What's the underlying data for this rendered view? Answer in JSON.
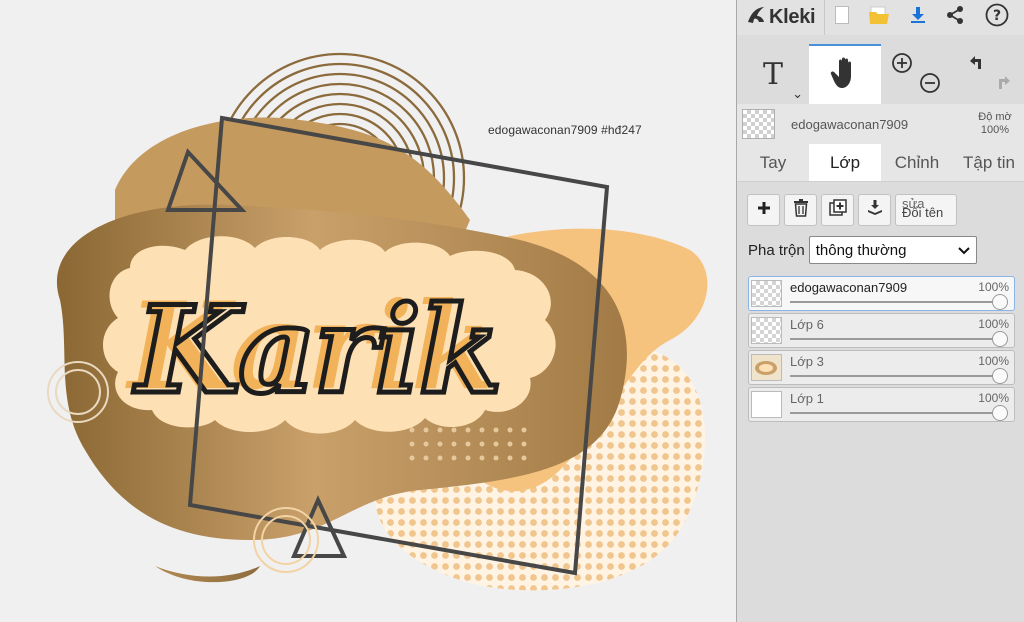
{
  "app": {
    "title": "Kleki"
  },
  "topbar": {
    "icons": [
      "kleki-logo-icon",
      "new-document-icon",
      "open-folder-icon",
      "download-icon",
      "share-icon",
      "help-icon"
    ]
  },
  "tools": {
    "text_label": "T",
    "items": [
      "text-tool-icon",
      "hand-tool-icon",
      "zoom-in-icon",
      "zoom-out-icon",
      "undo-icon",
      "redo-icon"
    ]
  },
  "layer_info": {
    "name": "edogawaconan7909",
    "opacity_label": "Độ mờ",
    "opacity_value": "100%"
  },
  "tabs": [
    {
      "label": "Tay",
      "active": false
    },
    {
      "label": "Lớp",
      "active": true
    },
    {
      "label": "Chỉnh",
      "active": false
    },
    {
      "label": "Tập tin",
      "active": false
    }
  ],
  "layer_buttons": {
    "rename_label_top": "sửa",
    "rename_label": "Đổi tên"
  },
  "blend": {
    "label": "Pha trộn",
    "selected": "thông thường"
  },
  "layers": [
    {
      "name": "edogawaconan7909",
      "opacity": "100%",
      "opacity_value": 1.0,
      "selected": true
    },
    {
      "name": "Lớp 6",
      "opacity": "100%",
      "opacity_value": 1.0,
      "selected": false
    },
    {
      "name": "Lớp 3",
      "opacity": "100%",
      "opacity_value": 1.0,
      "selected": false
    },
    {
      "name": "Lớp 1",
      "opacity": "100%",
      "opacity_value": 1.0,
      "selected": false
    }
  ],
  "canvas": {
    "artwork_text": "Karik",
    "watermark": "edogawaconan7909    #hđ247",
    "colors": {
      "gold_dark": "#9a7440",
      "gold_light": "#d8b27a",
      "peach": "#f6c37f",
      "cream": "#fde0b4",
      "frame": "#4a4a4a"
    }
  }
}
